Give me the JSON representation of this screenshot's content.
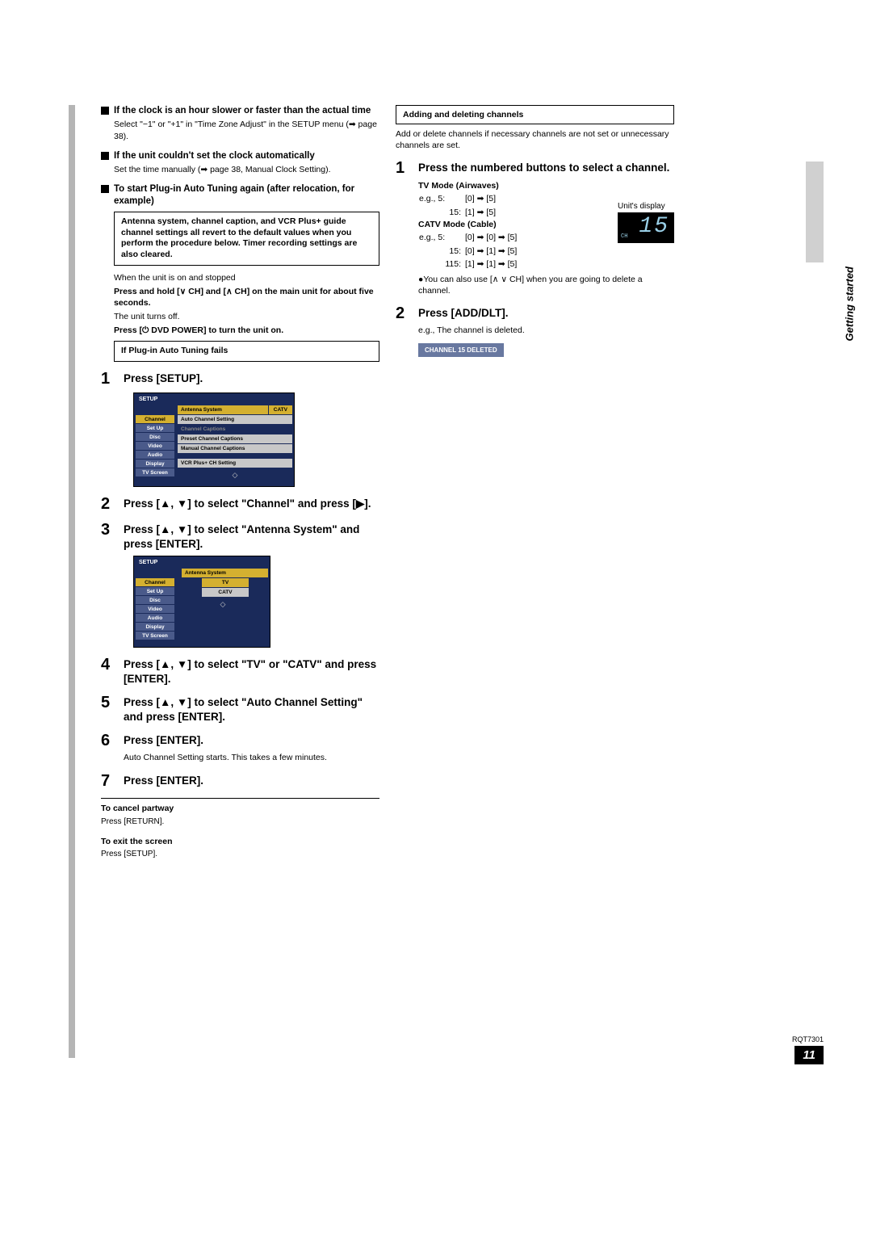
{
  "side_label": "Getting started",
  "footer_id": "RQT7301",
  "footer_page": "11",
  "left": {
    "h1": "If the clock is an hour slower or faster than the actual time",
    "h1_body": "Select \"−1\" or \"+1\" in \"Time Zone Adjust\" in the SETUP menu (➡ page 38).",
    "h2": "If the unit couldn't set the clock automatically",
    "h2_body": "Set the time manually (➡ page 38, Manual Clock Setting).",
    "h3": "To start Plug-in Auto Tuning again (after relocation, for example)",
    "box1": "Antenna system, channel caption, and VCR Plus+ guide channel settings all revert to the default values when you perform the procedure below. Timer recording settings are also cleared.",
    "steps_intro": "When the unit is on and stopped",
    "steps_b1": "Press and hold [∨ CH] and [∧ CH] on the main unit for about five seconds.",
    "steps_p2": "The unit turns off.",
    "steps_b2": "Press [⏻ DVD POWER] to turn the unit on.",
    "box2": "If Plug-in Auto Tuning fails",
    "s1": "Press [SETUP].",
    "menu1": {
      "setup": "SETUP",
      "nav": [
        "Channel",
        "Set Up",
        "Disc",
        "Video",
        "Audio",
        "Display",
        "TV Screen"
      ],
      "hdr": "Antenna System",
      "hdr_val": "CATV",
      "items": [
        "Auto Channel Setting",
        "Channel Captions",
        "Preset Channel Captions",
        "Manual Channel Captions",
        "",
        "VCR Plus+ CH Setting"
      ]
    },
    "s2": "Press [▲, ▼] to select \"Channel\" and press [▶].",
    "s3": "Press [▲, ▼] to select \"Antenna System\" and press [ENTER].",
    "menu2": {
      "setup": "SETUP",
      "nav": [
        "Channel",
        "Set Up",
        "Disc",
        "Video",
        "Audio",
        "Display",
        "TV Screen"
      ],
      "hdr": "Antenna System",
      "opts": [
        "TV",
        "CATV"
      ]
    },
    "s4": "Press [▲, ▼] to select \"TV\" or \"CATV\" and press [ENTER].",
    "s5": "Press [▲, ▼] to select \"Auto Channel Setting\" and press [ENTER].",
    "s6": "Press [ENTER].",
    "s6_sub": "Auto Channel Setting starts. This takes a few minutes.",
    "s7": "Press [ENTER].",
    "cancel_h": "To cancel partway",
    "cancel_b": "Press [RETURN].",
    "exit_h": "To exit the screen",
    "exit_b": "Press [SETUP]."
  },
  "right": {
    "box1": "Adding and deleting channels",
    "intro": "Add or delete channels if necessary channels are not set or unnecessary channels are set.",
    "s1": "Press the numbered buttons to select a channel.",
    "unit_display_label": "Unit's display",
    "lcd_ch": "CH",
    "lcd_val": "15",
    "tv_mode": "TV Mode (Airwaves)",
    "tv_r1a": "e.g.,  5:",
    "tv_r1b": "[0] ➡ [5]",
    "tv_r2a": "15:",
    "tv_r2b": "[1] ➡ [5]",
    "catv_mode": "CATV Mode (Cable)",
    "catv_r1a": "e.g.,  5:",
    "catv_r1b": "[0] ➡ [0] ➡ [5]",
    "catv_r2a": "15:",
    "catv_r2b": "[0] ➡ [1] ➡ [5]",
    "catv_r3a": "115:",
    "catv_r3b": "[1] ➡ [1] ➡ [5]",
    "note": "●You can also use [∧ ∨ CH] when you are going to delete a channel.",
    "s2": "Press [ADD/DLT].",
    "s2_sub": "e.g., The channel is deleted.",
    "deleted": "CHANNEL 15 DELETED"
  }
}
